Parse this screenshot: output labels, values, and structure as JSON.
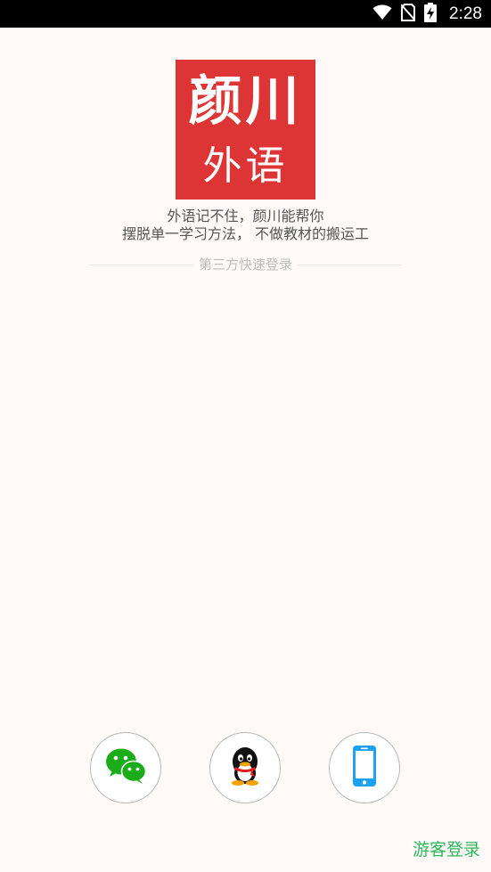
{
  "status_bar": {
    "time": "2:28",
    "icons": [
      "wifi-icon",
      "no-sim-icon",
      "battery-charging-icon"
    ]
  },
  "logo": {
    "line1": "颜川",
    "line2": "外语",
    "background_color": "#dd3535"
  },
  "slogan": {
    "line1": "外语记不住，颜川能帮你",
    "line2": "摆脱单一学习方法， 不做教材的搬运工"
  },
  "quick_login": {
    "title": "第三方快速登录",
    "options": [
      "wechat-icon",
      "qq-icon",
      "phone-icon"
    ]
  },
  "guest_login": {
    "label": "游客登录",
    "color": "#2eb85c"
  }
}
